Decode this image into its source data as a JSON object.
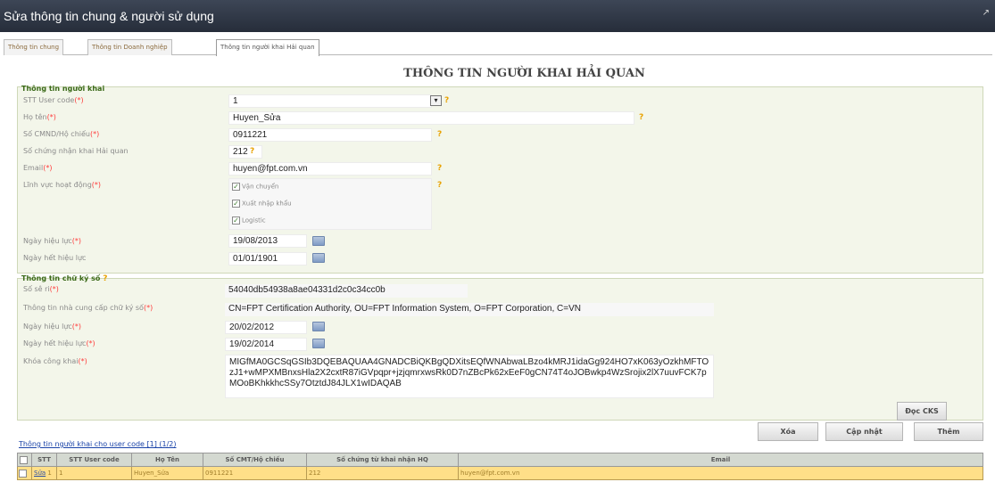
{
  "window": {
    "title": "Sửa thông tin chung & người sử dụng",
    "restore_glyph": "↗"
  },
  "tabs": [
    {
      "label": "Thông tin chung"
    },
    {
      "label": "Thông tin Doanh nghiệp"
    },
    {
      "label": "Thông tin người khai Hải quan"
    }
  ],
  "page_title": "THÔNG TIN NGƯỜI KHAI HẢI QUAN",
  "help_mark": "?",
  "required_mark": "(*)",
  "declarant": {
    "section": "Thông tin người khai",
    "stt_label": "STT User code",
    "stt_value": "1",
    "name_label": "Họ tên",
    "name_value": "Huyen_Sửa",
    "id_label": "Số CMND/Hộ chiếu",
    "id_value": "0911221",
    "cert_label": "Số chứng nhận khai Hải quan",
    "cert_value": "212",
    "email_label": "Email",
    "email_value": "huyen@fpt.com.vn",
    "field_label": "Lĩnh vực hoạt động",
    "fields": [
      {
        "label": "Vận chuyển",
        "checked": true
      },
      {
        "label": "Xuất nhập khẩu",
        "checked": true
      },
      {
        "label": "Logistic",
        "checked": true
      }
    ],
    "eff_label": "Ngày hiệu lực",
    "eff_value": "19/08/2013",
    "exp_label": "Ngày hết hiệu lực",
    "exp_value": "01/01/1901"
  },
  "signature": {
    "section": "Thông tin chữ ký số",
    "serial_label": "Số sê ri",
    "serial_value": "54040db54938a8ae04331d2c0c34cc0b",
    "provider_label": "Thông tin nhà cung cấp chữ ký số",
    "provider_value": "CN=FPT Certification Authority, OU=FPT Information System, O=FPT Corporation, C=VN",
    "eff_label": "Ngày hiệu lực",
    "eff_value": "20/02/2012",
    "exp_label": "Ngày hết hiệu lực",
    "exp_value": "19/02/2014",
    "key_label": "Khóa công khai",
    "key_value": "MIGfMA0GCSqGSIb3DQEBAQUAA4GNADCBiQKBgQDXitsEQfWNAbwaLBzo4kMRJ1idaGg924HO7xK063yOzkhMFTOzJ1+wMPXMBnxsHla2X2cxtR87iGVpqpr+jzjqmrxwsRk0D7nZBcPk62xEeF0gCN74T4oJOBwkp4WzSrojix2lX7uuvFCK7pMOoBKhkkhcSSy7OtztdJ84JLX1wIDAQAB",
    "read_button": "Đọc CKS"
  },
  "actions": {
    "delete": "Xóa",
    "update": "Cập nhật",
    "add": "Thêm"
  },
  "table": {
    "caption": "Thông tin người khai cho user code [1] (1/2)",
    "headers": [
      "",
      "STT",
      "STT User code",
      "Họ Tên",
      "Số CMT/Hộ chiếu",
      "Số chứng từ khai nhận HQ",
      "Email"
    ],
    "rows": [
      {
        "action": "Sửa",
        "stt": "1",
        "code": "1",
        "name": "Huyen_Sửa",
        "id": "0911221",
        "cert": "212",
        "email": "huyen@fpt.com.vn"
      }
    ]
  }
}
